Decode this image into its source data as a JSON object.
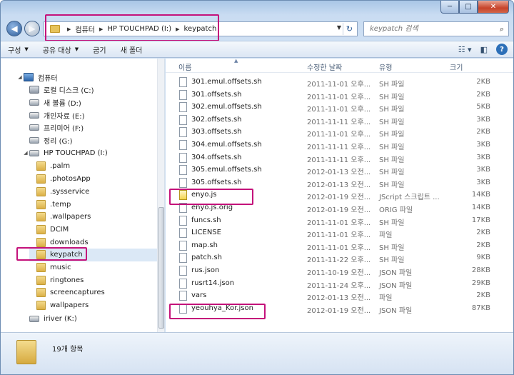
{
  "window": {
    "controls": {
      "minimize": "─",
      "maximize": "□",
      "close": "✕"
    }
  },
  "address": {
    "crumbs": [
      "컴퓨터",
      "HP TOUCHPAD (I:)",
      "keypatch"
    ],
    "search_placeholder": "keypatch 검색"
  },
  "toolbar": {
    "organize": "구성",
    "share": "공유 대상",
    "burn": "굽기",
    "new_folder": "새 폴더"
  },
  "nav": {
    "items": [
      {
        "label": "컴퓨터",
        "icon": "computer-icon",
        "level": 0
      },
      {
        "label": "로컬 디스크 (C:)",
        "icon": "windows-drive-icon",
        "level": 1
      },
      {
        "label": "새 볼륨 (D:)",
        "icon": "drive-icon",
        "level": 1
      },
      {
        "label": "개인자료 (E:)",
        "icon": "drive-icon",
        "level": 1
      },
      {
        "label": "프리미어 (F:)",
        "icon": "drive-icon",
        "level": 1
      },
      {
        "label": "정리 (G:)",
        "icon": "drive-icon",
        "level": 1
      },
      {
        "label": "HP TOUCHPAD (I:)",
        "icon": "removable-drive-icon",
        "level": 1,
        "expanded": true
      },
      {
        "label": ".palm",
        "icon": "folder-icon",
        "level": 2
      },
      {
        "label": ".photosApp",
        "icon": "folder-icon",
        "level": 2
      },
      {
        "label": ".sysservice",
        "icon": "folder-icon",
        "level": 2
      },
      {
        "label": ".temp",
        "icon": "folder-icon",
        "level": 2
      },
      {
        "label": ".wallpapers",
        "icon": "folder-icon",
        "level": 2
      },
      {
        "label": "DCIM",
        "icon": "folder-icon",
        "level": 2
      },
      {
        "label": "downloads",
        "icon": "folder-icon",
        "level": 2
      },
      {
        "label": "keypatch",
        "icon": "folder-icon",
        "level": 2,
        "selected": true
      },
      {
        "label": "music",
        "icon": "folder-icon",
        "level": 2
      },
      {
        "label": "ringtones",
        "icon": "folder-icon",
        "level": 2
      },
      {
        "label": "screencaptures",
        "icon": "folder-icon",
        "level": 2
      },
      {
        "label": "wallpapers",
        "icon": "folder-icon",
        "level": 2
      },
      {
        "label": "iriver (K:)",
        "icon": "drive-icon",
        "level": 1
      }
    ]
  },
  "columns": {
    "name": "이름",
    "date": "수정한 날짜",
    "type": "유형",
    "size": "크기"
  },
  "files": [
    {
      "name": "301.emul.offsets.sh",
      "date": "2011-11-01 오후...",
      "type": "SH 파일",
      "size": "2KB"
    },
    {
      "name": "301.offsets.sh",
      "date": "2011-11-01 오후...",
      "type": "SH 파일",
      "size": "2KB"
    },
    {
      "name": "302.emul.offsets.sh",
      "date": "2011-11-01 오후...",
      "type": "SH 파일",
      "size": "5KB"
    },
    {
      "name": "302.offsets.sh",
      "date": "2011-11-11 오후...",
      "type": "SH 파일",
      "size": "3KB"
    },
    {
      "name": "303.offsets.sh",
      "date": "2011-11-01 오후...",
      "type": "SH 파일",
      "size": "2KB"
    },
    {
      "name": "304.emul.offsets.sh",
      "date": "2011-11-11 오후...",
      "type": "SH 파일",
      "size": "3KB"
    },
    {
      "name": "304.offsets.sh",
      "date": "2011-11-11 오후...",
      "type": "SH 파일",
      "size": "3KB"
    },
    {
      "name": "305.emul.offsets.sh",
      "date": "2012-01-13 오전...",
      "type": "SH 파일",
      "size": "3KB"
    },
    {
      "name": "305.offsets.sh",
      "date": "2012-01-13 오전...",
      "type": "SH 파일",
      "size": "3KB"
    },
    {
      "name": "enyo.js",
      "date": "2012-01-19 오전...",
      "type": "JScript 스크립트 ...",
      "size": "14KB",
      "icon": "jscript-icon"
    },
    {
      "name": "enyo.js.orig",
      "date": "2012-01-19 오전...",
      "type": "ORIG 파일",
      "size": "14KB"
    },
    {
      "name": "funcs.sh",
      "date": "2011-11-01 오후...",
      "type": "SH 파일",
      "size": "17KB"
    },
    {
      "name": "LICENSE",
      "date": "2011-11-01 오후...",
      "type": "파일",
      "size": "2KB"
    },
    {
      "name": "map.sh",
      "date": "2011-11-01 오후...",
      "type": "SH 파일",
      "size": "2KB"
    },
    {
      "name": "patch.sh",
      "date": "2011-11-22 오후...",
      "type": "SH 파일",
      "size": "9KB"
    },
    {
      "name": "rus.json",
      "date": "2011-10-19 오전...",
      "type": "JSON 파일",
      "size": "28KB"
    },
    {
      "name": "rusrt14.json",
      "date": "2011-11-24 오후...",
      "type": "JSON 파일",
      "size": "29KB"
    },
    {
      "name": "vars",
      "date": "2012-01-13 오전...",
      "type": "파일",
      "size": "2KB"
    },
    {
      "name": "yeouhya_Kor.json",
      "date": "2012-01-19 오전...",
      "type": "JSON 파일",
      "size": "87KB"
    }
  ],
  "status": {
    "count": "19개 항목"
  },
  "colors": {
    "highlight": "#c4127b",
    "selection": "#dbe8f6",
    "window_frame": "#a9c6e6"
  }
}
